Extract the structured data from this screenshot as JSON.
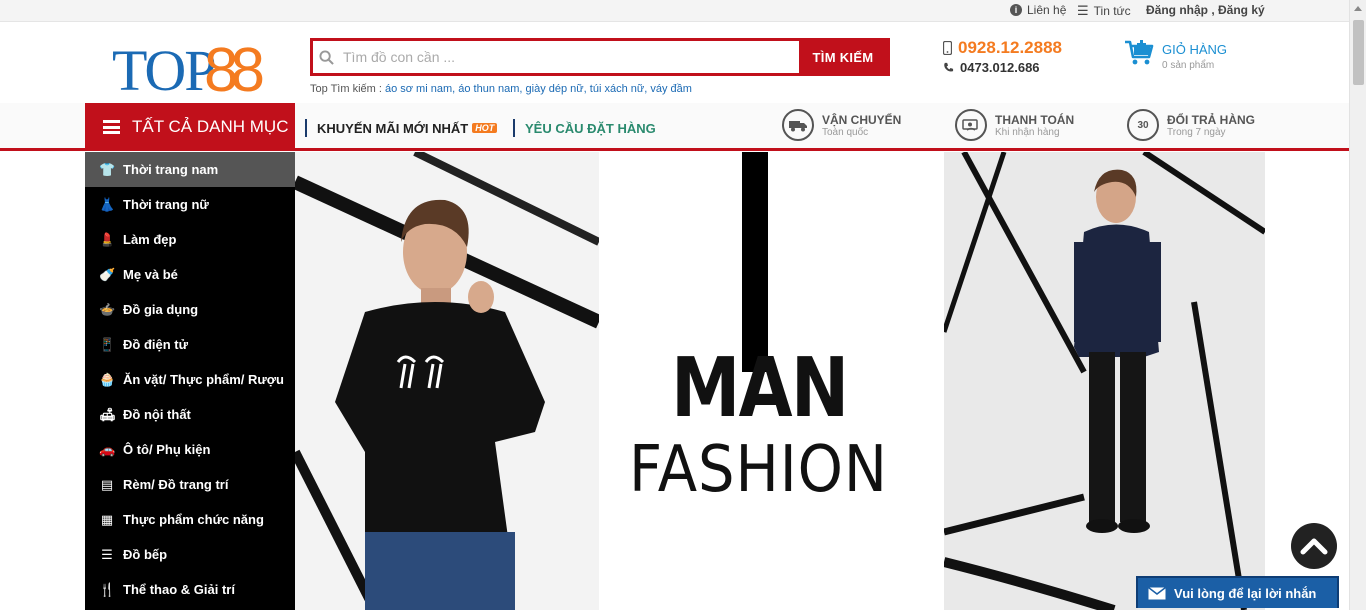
{
  "topbar": {
    "contact": "Liên hệ",
    "news": "Tin tức",
    "auth": "Đăng nhập , Đăng ký"
  },
  "logo": {
    "text_top": "TOP",
    "text_num": "88"
  },
  "search": {
    "placeholder": "Tìm đồ con cần ...",
    "button": "TÌM KIẾM"
  },
  "top_search": {
    "label": "Top Tìm kiếm :",
    "keywords": [
      "áo sơ mi nam,",
      "áo thun nam,",
      "giày dép nữ,",
      "túi xách nữ,",
      "váy đầm"
    ]
  },
  "hotline": {
    "mobile": "0928.12.2888",
    "phone": "0473.012.686"
  },
  "cart": {
    "title": "GIỎ HÀNG",
    "count": "0 sản phẩm"
  },
  "nav": {
    "all_categories": "TẤT CẢ DANH MỤC",
    "promo": "KHUYẾN MÃI MỚI NHẤT",
    "hot_badge": "HOT",
    "order_request": "YÊU CẦU ĐẶT HÀNG",
    "services": [
      {
        "title": "VẬN CHUYỂN",
        "sub": "Toàn quốc",
        "icon": "truck-icon"
      },
      {
        "title": "THANH TOÁN",
        "sub": "Khi nhận hàng",
        "icon": "payment-icon"
      },
      {
        "title": "ĐỔI TRẢ HÀNG",
        "sub": "Trong 7 ngày",
        "icon": "return-30-icon",
        "badge": "30"
      }
    ]
  },
  "categories": [
    {
      "label": "Thời trang nam",
      "icon": "shirt-icon",
      "glyph": "👕"
    },
    {
      "label": "Thời trang nữ",
      "icon": "dress-icon",
      "glyph": "👗"
    },
    {
      "label": "Làm đẹp",
      "icon": "cosmetics-icon",
      "glyph": "💄"
    },
    {
      "label": "Mẹ và bé",
      "icon": "baby-bottle-icon",
      "glyph": "🍼"
    },
    {
      "label": "Đồ gia dụng",
      "icon": "pot-icon",
      "glyph": "🍲"
    },
    {
      "label": "Đồ điện tử",
      "icon": "phone-icon",
      "glyph": "📱"
    },
    {
      "label": "Ăn vặt/ Thực phẩm/ Rượu",
      "icon": "cake-icon",
      "glyph": "🧁"
    },
    {
      "label": "Đồ nội thất",
      "icon": "sofa-icon",
      "glyph": "🛋"
    },
    {
      "label": "Ô tô/ Phụ kiện",
      "icon": "car-icon",
      "glyph": "🚗"
    },
    {
      "label": "Rèm/ Đồ trang trí",
      "icon": "curtain-icon",
      "glyph": "▤"
    },
    {
      "label": "Thực phẩm chức năng",
      "icon": "supplement-icon",
      "glyph": "▦"
    },
    {
      "label": "Đồ bếp",
      "icon": "dishes-icon",
      "glyph": "☰"
    },
    {
      "label": "Thể thao & Giải trí",
      "icon": "sport-icon",
      "glyph": "🍴"
    }
  ],
  "banner": {
    "title": "MAN",
    "subtitle": "FASHION"
  },
  "chat": {
    "label": "Vui lòng để lại lời nhắn"
  },
  "colors": {
    "brand_red": "#c1101b",
    "brand_blue": "#1b6ab4",
    "brand_orange": "#f47b20",
    "chat_blue": "#1b5fa6"
  }
}
